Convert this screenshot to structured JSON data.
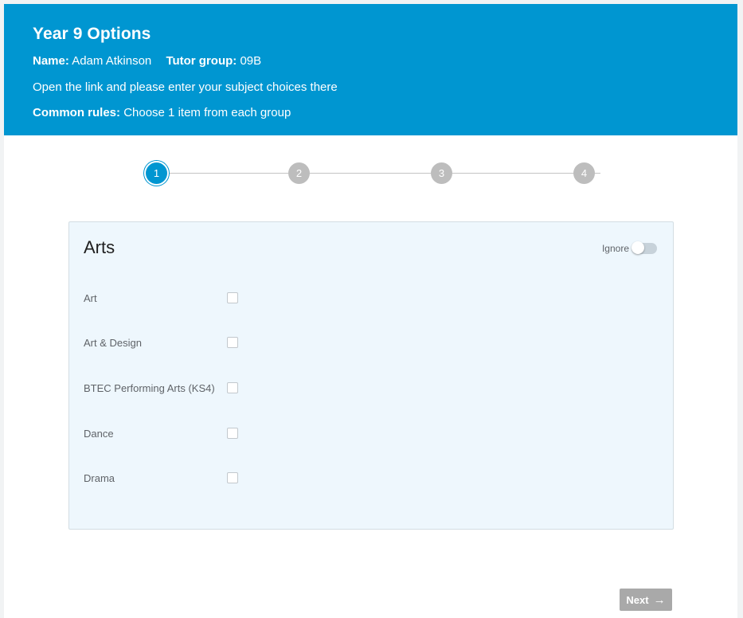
{
  "header": {
    "title": "Year 9 Options",
    "name_label": "Name:",
    "name_value": "Adam Atkinson",
    "tutor_label": "Tutor group:",
    "tutor_value": "09B",
    "instruction": "Open the link and please enter your subject choices there",
    "rules_label": "Common rules:",
    "rules_value": "Choose 1 item from each group"
  },
  "stepper": {
    "current": 1,
    "steps": [
      "1",
      "2",
      "3",
      "4"
    ]
  },
  "group": {
    "title": "Arts",
    "ignore_label": "Ignore",
    "ignore_on": false,
    "options": [
      {
        "label": "Art",
        "checked": false
      },
      {
        "label": "Art & Design",
        "checked": false
      },
      {
        "label": "BTEC Performing Arts (KS4)",
        "checked": false
      },
      {
        "label": "Dance",
        "checked": false
      },
      {
        "label": "Drama",
        "checked": false
      }
    ]
  },
  "footer": {
    "next_label": "Next",
    "next_icon": "arrow-right-icon"
  },
  "colors": {
    "brand": "#0096d1",
    "step_inactive": "#bdbdbd",
    "card_bg": "#eef7fd",
    "button_disabled": "#a9a9a9"
  }
}
